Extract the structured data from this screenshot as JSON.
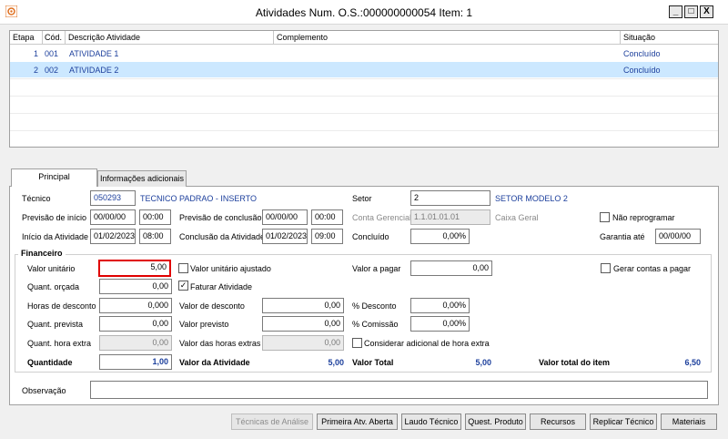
{
  "window": {
    "title": "Atividades Num. O.S.:000000000054  Item:    1",
    "minimize": "_",
    "maximize": "□",
    "close": "X"
  },
  "grid": {
    "columns": [
      "Etapa",
      "Cód.",
      "Descrição Atividade",
      "Complemento",
      "Situação"
    ],
    "rows": [
      {
        "etapa": "1",
        "cod": "001",
        "descricao": "ATIVIDADE 1",
        "complemento": "",
        "situacao": "Concluído"
      },
      {
        "etapa": "2",
        "cod": "002",
        "descricao": "ATIVIDADE 2",
        "complemento": "",
        "situacao": "Concluído"
      }
    ],
    "selected_row_color": "#cce8ff"
  },
  "tabs": [
    {
      "label": "Principal"
    },
    {
      "label": "Informações adicionais"
    }
  ],
  "form": {
    "tecnico_label": "Técnico",
    "tecnico_code": "050293",
    "tecnico_name": "TECNICO PADRAO - INSERTO",
    "setor_label": "Setor",
    "setor_code": "2",
    "setor_name": "SETOR MODELO 2",
    "previsao_inicio_label": "Previsão de início",
    "previsao_inicio_date": "00/00/00",
    "previsao_inicio_time": "00:00",
    "previsao_conclusao_label": "Previsão de conclusão",
    "previsao_conclusao_date": "00/00/00",
    "previsao_conclusao_time": "00:00",
    "conta_gerencial_label": "Conta Gerencial",
    "conta_gerencial_value": "1.1.01.01.01",
    "conta_gerencial_name": "Caixa Geral",
    "nao_reprogramar_label": "Não reprogramar",
    "inicio_atividade_label": "Início da Atividade",
    "inicio_atividade_date": "01/02/2023",
    "inicio_atividade_time": "08:00",
    "conclusao_atividade_label": "Conclusão da Atividade",
    "conclusao_atividade_date": "01/02/2023",
    "conclusao_atividade_time": "09:00",
    "concluido_label": "Concluído",
    "concluido_value": "0,00%",
    "garantia_label": "Garantia até",
    "garantia_value": "00/00/00"
  },
  "financeiro": {
    "group_label": "Financeiro",
    "valor_unitario_label": "Valor unitário",
    "valor_unitario_value": "5,00",
    "valor_unitario_ajustado_label": "Valor unitário ajustado",
    "valor_a_pagar_label": "Valor a pagar",
    "valor_a_pagar_value": "0,00",
    "gerar_contas_label": "Gerar contas a pagar",
    "quant_orcada_label": "Quant. orçada",
    "quant_orcada_value": "0,00",
    "faturar_atividade_label": "Faturar Atividade",
    "horas_desconto_label": "Horas de desconto",
    "horas_desconto_value": "0,000",
    "valor_desconto_label": "Valor de desconto",
    "valor_desconto_value": "0,00",
    "pct_desconto_label": "% Desconto",
    "pct_desconto_value": "0,00%",
    "quant_prevista_label": "Quant. prevista",
    "quant_prevista_value": "0,00",
    "valor_previsto_label": "Valor previsto",
    "valor_previsto_value": "0,00",
    "pct_comissao_label": "% Comissão",
    "pct_comissao_value": "0,00%",
    "quant_hora_extra_label": "Quant. hora extra",
    "quant_hora_extra_value": "0,00",
    "valor_horas_extras_label": "Valor das horas extras",
    "valor_horas_extras_value": "0,00",
    "considerar_adicional_label": "Considerar adicional de hora extra",
    "quantidade_label": "Quantidade",
    "quantidade_value": "1,00",
    "valor_atividade_label": "Valor da Atividade",
    "valor_atividade_value": "5,00",
    "valor_total_label": "Valor Total",
    "valor_total_value": "5,00",
    "valor_total_item_label": "Valor total do item",
    "valor_total_item_value": "6,50",
    "highlight_color": "#e00000"
  },
  "observacao": {
    "label": "Observação",
    "value": ""
  },
  "buttons": {
    "tecnicas": "Técnicas de Análise",
    "primeira_atv": "Primeira Atv. Aberta",
    "laudo": "Laudo Técnico",
    "quest": "Quest. Produto",
    "recursos": "Recursos",
    "replicar": "Replicar Técnico",
    "materiais": "Materiais"
  }
}
